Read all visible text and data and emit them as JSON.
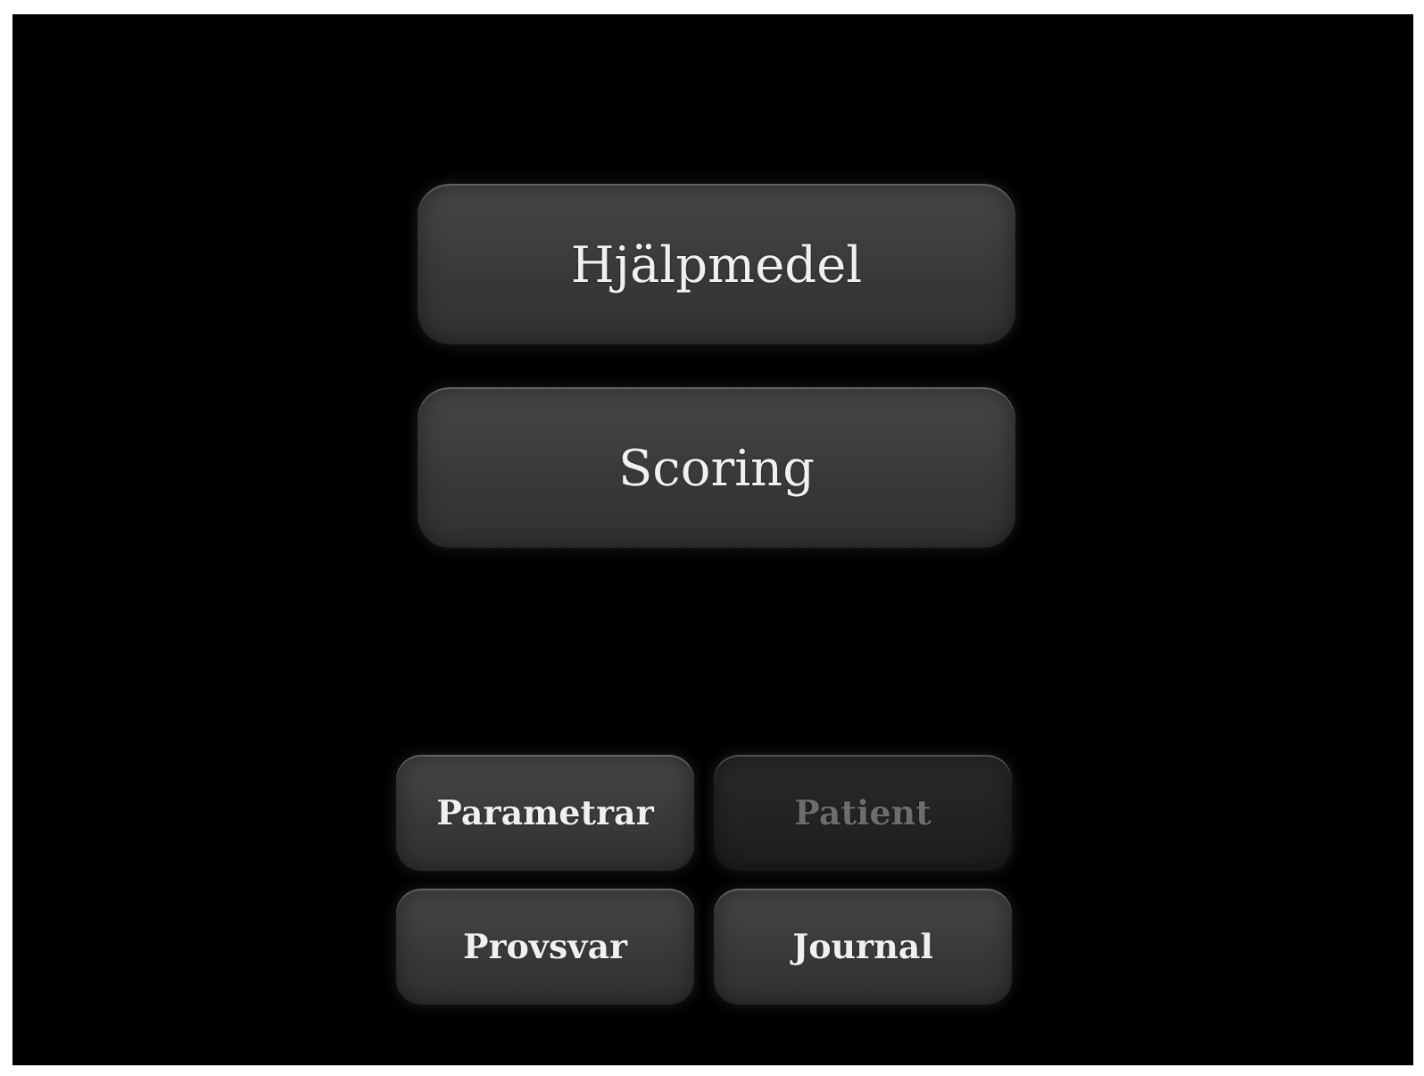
{
  "main_buttons": [
    {
      "label": "Hjälpmedel",
      "disabled": false
    },
    {
      "label": "Scoring",
      "disabled": false
    }
  ],
  "small_buttons": [
    {
      "label": "Parametrar",
      "disabled": false
    },
    {
      "label": "Patient",
      "disabled": true
    },
    {
      "label": "Provsvar",
      "disabled": false
    },
    {
      "label": "Journal",
      "disabled": false
    }
  ]
}
